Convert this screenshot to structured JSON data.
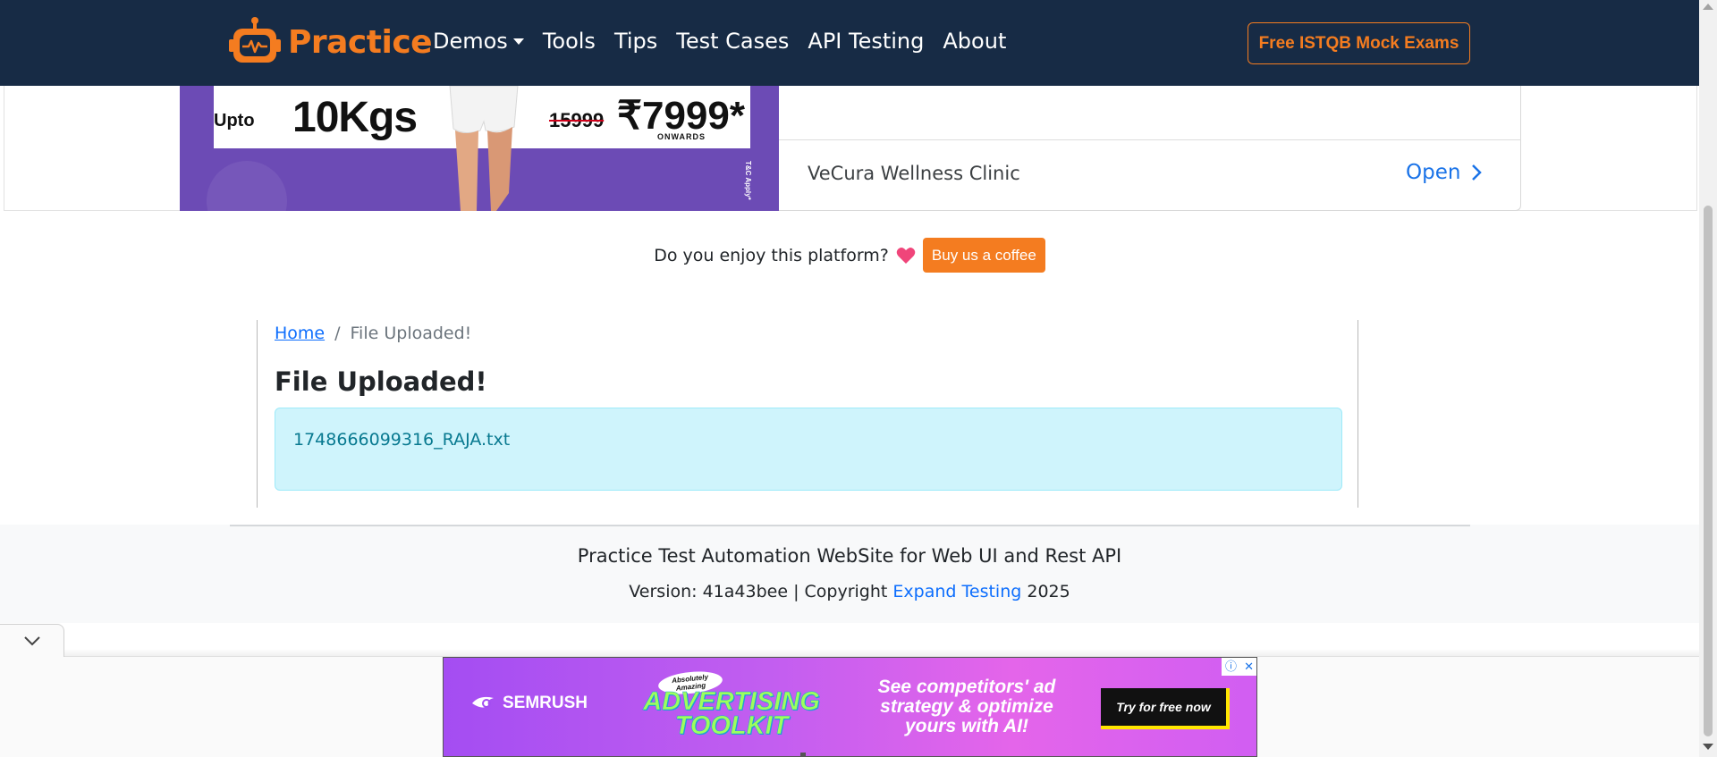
{
  "navbar": {
    "brand": "Practice",
    "links": [
      "Demos",
      "Tools",
      "Tips",
      "Test Cases",
      "API Testing",
      "About"
    ],
    "cta": "Free ISTQB Mock Exams",
    "bg_color": "#172b45",
    "accent_color": "#f47c20"
  },
  "top_ad": {
    "upto": "Upto",
    "weight": "10Kgs",
    "old_price": "15999",
    "price": "₹7999*",
    "onwards": "ONWARDS",
    "terms": "T&C Apply*",
    "advertiser": "VeCura Wellness Clinic",
    "open_label": "Open",
    "open_icon": "chevron-right-icon"
  },
  "coffee": {
    "text": "Do you enjoy this platform?",
    "icon": "heart-icon",
    "button": "Buy us a coffee"
  },
  "breadcrumb": {
    "home": "Home",
    "separator": "/",
    "current": "File Uploaded!"
  },
  "main": {
    "title": "File Uploaded!",
    "uploaded_file": "1748666099316_RAJA.txt"
  },
  "footer": {
    "title": "Practice Test Automation WebSite for Web UI and Rest API",
    "version_prefix": "Version: 41a43bee | Copyright",
    "link": "Expand Testing",
    "year": "2025"
  },
  "bottom_ad": {
    "collapse_icon": "chevron-down-icon",
    "brand": "SEMRUSH",
    "badge": "Absolutely Amazing",
    "headline_line1": "ADVERTISING",
    "headline_line2": "TOOLKIT",
    "copy": "See competitors' ad strategy & optimize yours with AI!",
    "cta": "Try for free now",
    "info_icon": "ⓘ",
    "close_icon": "✕"
  }
}
